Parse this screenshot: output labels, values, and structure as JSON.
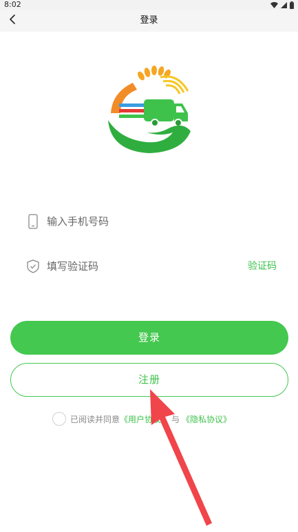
{
  "status_bar": {
    "time": "8:02"
  },
  "nav": {
    "title": "登录"
  },
  "form": {
    "phone_placeholder": "输入手机号码",
    "code_placeholder": "填写验证码",
    "get_code_label": "验证码"
  },
  "actions": {
    "login_label": "登录",
    "register_label": "注册"
  },
  "agreement": {
    "prefix": "已阅读并同意",
    "user_agreement": "《用户协议》",
    "and": "与",
    "privacy_policy": "《隐私协议》"
  },
  "colors": {
    "accent": "#44c84f",
    "accent_text": "#3ec24c",
    "annotation_arrow": "#f0454a"
  }
}
